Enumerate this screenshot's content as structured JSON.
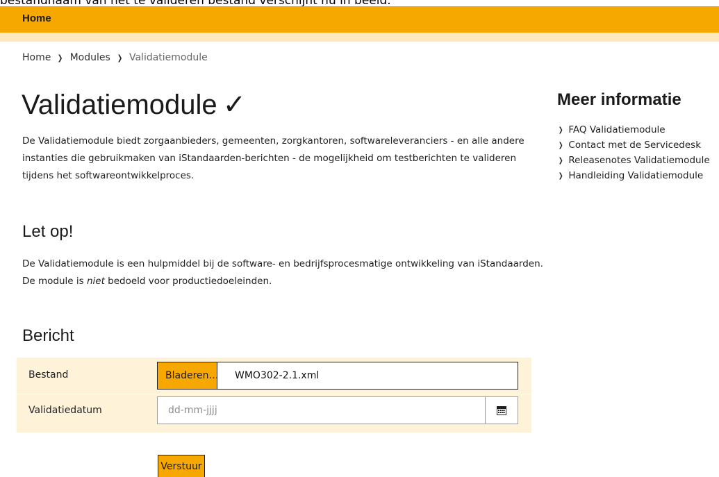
{
  "caption": "bestandnaam van het te valideren bestand verschijnt nu in beeld.",
  "nav": {
    "home": "Home"
  },
  "breadcrumb": {
    "items": [
      "Home",
      "Modules"
    ],
    "current": "Validatiemodule",
    "separator": "❯"
  },
  "page": {
    "title": "Validatiemodule",
    "title_icon": "✓",
    "intro": "De Validatiemodule biedt zorgaanbieders, gemeenten, zorgkantoren, softwareleveranciers - en alle andere instanties die gebruikmaken van iStandaarden-berichten - de mogelijkheid om testberichten te valideren tijdens het softwareontwikkelproces."
  },
  "letop": {
    "title": "Let op!",
    "text_before": "De Validatiemodule is een hulpmiddel bij de software- en bedrijfsprocesmatige ontwikkeling van iStandaarden. De module is ",
    "text_emphasis": "niet",
    "text_after": " bedoeld voor productiedoeleinden."
  },
  "form": {
    "title": "Bericht",
    "file_label": "Bestand",
    "browse_label": "Bladeren…",
    "file_value": "WMO302-2.1.xml",
    "date_label": "Validatiedatum",
    "date_placeholder": "dd-mm-jjjj",
    "date_value": "",
    "calendar_icon": "calendar-icon",
    "submit_label": "Verstuur"
  },
  "sidebar": {
    "title": "Meer informatie",
    "links": [
      "FAQ Validatiemodule",
      "Contact met de Servicedesk",
      "Releasenotes Validatiemodule",
      "Handleiding Validatiemodule"
    ]
  },
  "colors": {
    "accent": "#f7a800",
    "accent_light": "#fde9bd",
    "form_bg": "#fef3d9"
  }
}
